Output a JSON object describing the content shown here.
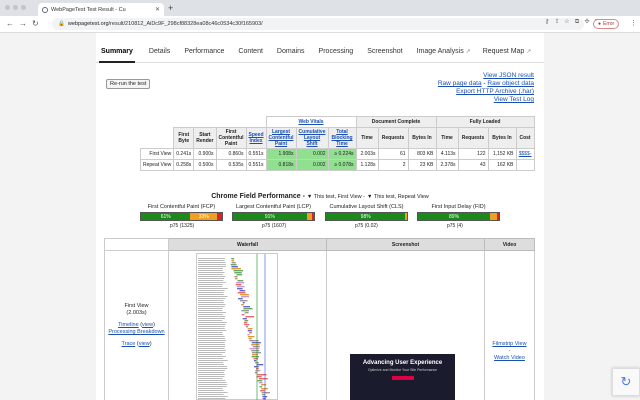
{
  "browser": {
    "tab_title": "WebPageTest Test Result - Cu",
    "url_host": "webpagetest.org",
    "url_path": "/result/210812_AiDc9F_298cf88328ea08c46c0534c30f165903/",
    "error_label": "Error"
  },
  "tabs": [
    {
      "label": "Summary",
      "active": true
    },
    {
      "label": "Details"
    },
    {
      "label": "Performance"
    },
    {
      "label": "Content"
    },
    {
      "label": "Domains"
    },
    {
      "label": "Processing"
    },
    {
      "label": "Screenshot"
    },
    {
      "label": "Image Analysis"
    },
    {
      "label": "Request Map"
    }
  ],
  "rerun_label": "Re-run the test",
  "links": [
    "View JSON result",
    "Raw page data",
    "Raw object data",
    "Export HTTP Archive (.har)",
    "View Test Log"
  ],
  "table": {
    "group_web_vitals": "Web Vitals",
    "group_doc_complete": "Document Complete",
    "group_fully_loaded": "Fully Loaded",
    "cols": [
      "First Byte",
      "Start Render",
      "First Contentful Paint",
      "Speed Index",
      "Largest Contentful Paint",
      "Cumulative Layout Shift",
      "Total Blocking Time",
      "Time",
      "Requests",
      "Bytes In",
      "Time",
      "Requests",
      "Bytes In",
      "Cost"
    ],
    "rows": [
      {
        "label": "First View",
        "cells": [
          "0.241s",
          "0.900s",
          "0.860s",
          "0.551s",
          "1.908s",
          "0.002",
          "≥ 0.224s",
          "2.003s",
          "61",
          "803 KB",
          "4.113s",
          "122",
          "1,152 KB",
          "$$$$-"
        ]
      },
      {
        "label": "Repeat View",
        "cells": [
          "0.258s",
          "0.500s",
          "0.535s",
          "0.551s",
          "0.818s",
          "0.002",
          "≥ 0.078s",
          "1.128s",
          "2",
          "23 KB",
          "2.378s",
          "43",
          "162 KB",
          ""
        ]
      }
    ]
  },
  "cfp": {
    "title": "Chrome Field Performance -",
    "legend1": "▼ This test, First View -",
    "legend2": "▼ This test, Repeat View"
  },
  "metrics": [
    {
      "name": "First Contentful Paint (FCP)",
      "good_label": "61%",
      "mid_label": "33%",
      "p75": "p75 (1325)",
      "good": 0.61,
      "mid": 0.33
    },
    {
      "name": "Largest Contentful Paint (LCP)",
      "good_label": "91%",
      "mid_label": "",
      "p75": "p75 (1607)",
      "good": 0.91,
      "mid": 0.06
    },
    {
      "name": "Cumulative Layout Shift (CLS)",
      "good_label": "98%",
      "mid_label": "",
      "p75": "p75 (0.02)",
      "good": 0.98,
      "mid": 0.015
    },
    {
      "name": "First Input Delay (FID)",
      "good_label": "89%",
      "mid_label": "",
      "p75": "p75 (4)",
      "good": 0.89,
      "mid": 0.08
    }
  ],
  "waterfall": {
    "col_waterfall": "Waterfall",
    "col_screenshot": "Screenshot",
    "col_video": "Video",
    "fv_label": "First View",
    "fv_time": "(2.003s)",
    "timeline": "Timeline",
    "view1": "view",
    "processing": "Processing Breakdown",
    "trace": "Trace",
    "view2": "view",
    "filmstrip": "Filmstrip View",
    "watch": "Watch Video"
  },
  "screenshot": {
    "headline": "Advancing User Experience",
    "sub": "Optimize and Monitor Your Site Performance"
  },
  "colors": {
    "good": "#1a8a1a",
    "mid": "#f0a020",
    "poor": "#d22"
  }
}
